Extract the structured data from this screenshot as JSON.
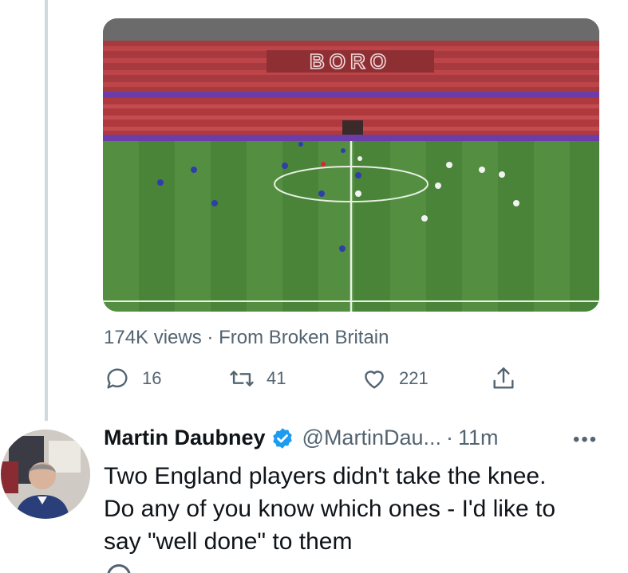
{
  "media": {
    "stadium_sign": "BORO"
  },
  "tweet_meta": {
    "views": "174K views",
    "separator": "·",
    "source": "From Broken Britain"
  },
  "actions": {
    "reply_count": "16",
    "retweet_count": "41",
    "like_count": "221"
  },
  "reply_tweet": {
    "display_name": "Martin Daubney",
    "handle": "@MartinDau...",
    "separator": "·",
    "time": "11m",
    "more": "•••",
    "text_lines": [
      "Two England players didn't take the knee.",
      "Do any of you know which ones - I'd like to",
      "say \"well done\" to them"
    ]
  },
  "colors": {
    "secondary_text": "#536471",
    "verified_blue": "#1d9bf0",
    "thread_line": "#cfd9de",
    "pitch_green": "#4f8f3f",
    "stands_red": "#b8383d"
  }
}
